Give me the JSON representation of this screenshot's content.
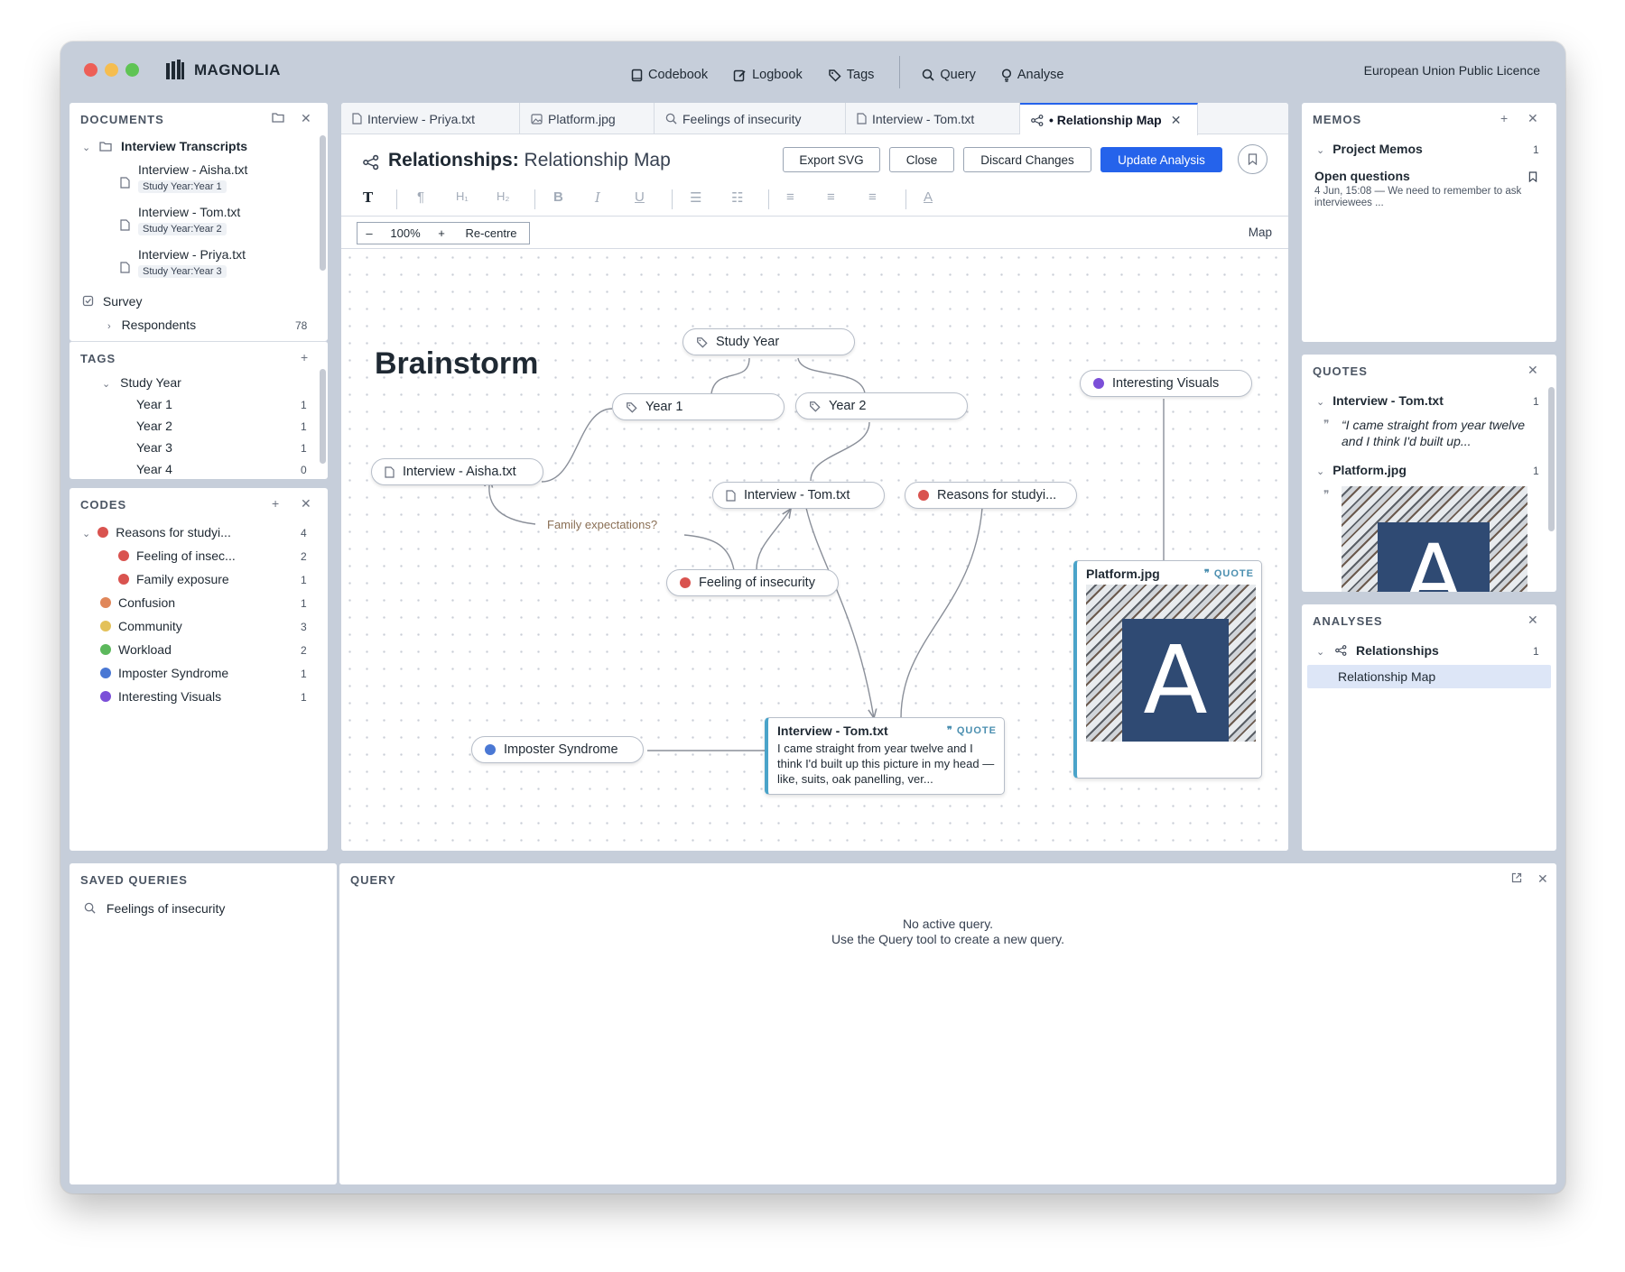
{
  "app": {
    "name": "MAGNOLIA",
    "licence": "European Union Public Licence"
  },
  "nav": [
    {
      "label": "Codebook"
    },
    {
      "label": "Logbook"
    },
    {
      "label": "Tags"
    },
    {
      "label": "Query"
    },
    {
      "label": "Analyse"
    }
  ],
  "documents": {
    "title": "DOCUMENTS",
    "folder": "Interview Transcripts",
    "items": [
      {
        "name": "Interview - Aisha.txt",
        "tag": "Study Year:Year 1"
      },
      {
        "name": "Interview - Tom.txt",
        "tag": "Study Year:Year 2"
      },
      {
        "name": "Interview - Priya.txt",
        "tag": "Study Year:Year 3"
      }
    ],
    "survey": "Survey",
    "respondents": "Respondents",
    "respondents_count": "78"
  },
  "tags": {
    "title": "TAGS",
    "group": "Study Year",
    "items": [
      {
        "name": "Year 1",
        "count": "1"
      },
      {
        "name": "Year 2",
        "count": "1"
      },
      {
        "name": "Year 3",
        "count": "1"
      },
      {
        "name": "Year 4",
        "count": "0"
      }
    ]
  },
  "codes": {
    "title": "CODES",
    "items": [
      {
        "name": "Reasons for studyi...",
        "count": "4",
        "color": "#d9534f"
      },
      {
        "name": "Feeling of insec...",
        "count": "2",
        "color": "#d9534f"
      },
      {
        "name": "Family exposure",
        "count": "1",
        "color": "#d9534f"
      },
      {
        "name": "Confusion",
        "count": "1",
        "color": "#e0875a"
      },
      {
        "name": "Community",
        "count": "3",
        "color": "#e3c15a"
      },
      {
        "name": "Workload",
        "count": "2",
        "color": "#5cb85c"
      },
      {
        "name": "Imposter Syndrome",
        "count": "1",
        "color": "#4a78d4"
      },
      {
        "name": "Interesting Visuals",
        "count": "1",
        "color": "#7b4fd8"
      }
    ]
  },
  "tabs": [
    {
      "label": "Interview - Priya.txt"
    },
    {
      "label": "Platform.jpg"
    },
    {
      "label": "Feelings of insecurity"
    },
    {
      "label": "Interview - Tom.txt"
    },
    {
      "label": "• Relationship Map"
    }
  ],
  "editor": {
    "title_bold": "Relationships:",
    "title_rest": "Relationship Map",
    "buttons": {
      "export": "Export SVG",
      "close": "Close",
      "discard": "Discard Changes",
      "update": "Update Analysis"
    },
    "zoom": {
      "minus": "–",
      "level": "100%",
      "plus": "+",
      "recentre": "Re-centre",
      "mode": "Map"
    }
  },
  "map": {
    "heading": "Brainstorm",
    "nodes": {
      "study_year": "Study Year",
      "year1": "Year 1",
      "year2": "Year 2",
      "aisha": "Interview - Aisha.txt",
      "tom": "Interview - Tom.txt",
      "reasons": "Reasons for studyi...",
      "feeling": "Feeling of insecurity",
      "imposter": "Imposter Syndrome",
      "visuals": "Interesting Visuals"
    },
    "edge_label": "Family expectations?",
    "quote_card": {
      "title": "Interview - Tom.txt",
      "label": "QUOTE",
      "text": "I came straight from year twelve and I think I'd built up this picture in my head — like, suits, oak panelling, ver..."
    },
    "image_card": {
      "title": "Platform.jpg",
      "label": "QUOTE",
      "sign_letter": "A"
    }
  },
  "memos": {
    "title": "MEMOS",
    "group": "Project Memos",
    "group_count": "1",
    "item_title": "Open questions",
    "item_meta": "4 Jun, 15:08 — We need to remember to ask interviewees ..."
  },
  "quotes": {
    "title": "QUOTES",
    "group1": "Interview - Tom.txt",
    "group1_count": "1",
    "quote": "“I came straight from year twelve and I think I'd built up...",
    "group2": "Platform.jpg",
    "group2_count": "1",
    "sign_letter": "A"
  },
  "analyses": {
    "title": "ANALYSES",
    "group": "Relationships",
    "group_count": "1",
    "item": "Relationship Map"
  },
  "saved_queries": {
    "title": "SAVED QUERIES",
    "item": "Feelings of insecurity"
  },
  "query": {
    "title": "QUERY",
    "empty_line1": "No active query.",
    "empty_line2": "Use the Query tool to create a new query."
  },
  "colors": {
    "accent": "#2563eb",
    "red": "#d9534f",
    "blue": "#4a78d4",
    "purple": "#7b4fd8"
  }
}
